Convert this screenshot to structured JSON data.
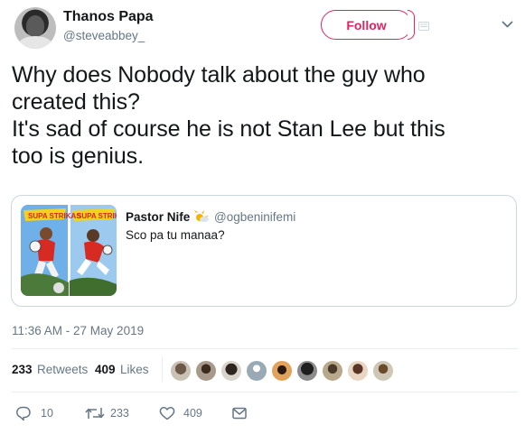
{
  "author": {
    "display_name": "Thanos Papa",
    "handle": "@steveabbey_",
    "avatar_icon": "user-avatar"
  },
  "header": {
    "follow_label": "Follow",
    "accent_color": "#e0245e"
  },
  "tweet": {
    "text": "Why does Nobody talk about the guy who\ncreated this?\nIt's sad of course he is not Stan Lee but this\ntoo is genius."
  },
  "quote": {
    "author_name": "Pastor Nife",
    "author_emoji": "sun-emoji",
    "author_handle": "@ogbeninifemi",
    "text": "Sco pa tu manaa?",
    "image_label": "SUPA STRIKAS"
  },
  "meta": {
    "timestamp": "11:36 AM - 27 May 2019"
  },
  "stats": {
    "retweets_count": "233",
    "retweets_label": "Retweets",
    "likes_count": "409",
    "likes_label": "Likes"
  },
  "actions": {
    "reply_count": "10",
    "retweet_count": "233",
    "like_count": "409"
  }
}
